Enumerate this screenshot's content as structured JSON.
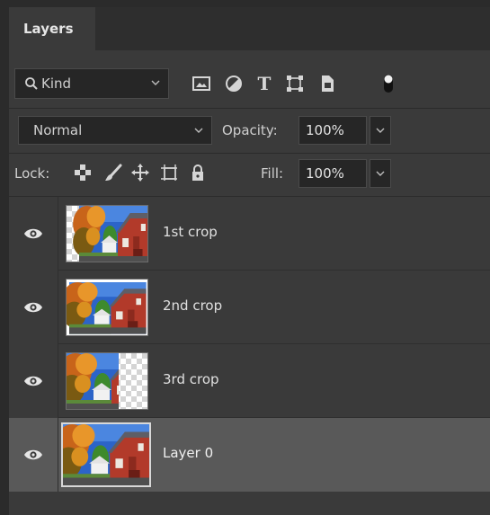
{
  "panel": {
    "tab_label": "Layers"
  },
  "filter": {
    "kind_label": "Kind",
    "icons": [
      "image-filter-icon",
      "adjustment-filter-icon",
      "type-filter-icon",
      "shape-filter-icon",
      "smart-object-filter-icon",
      "filter-toggle-icon"
    ]
  },
  "blend": {
    "mode": "Normal",
    "opacity_label": "Opacity:",
    "opacity_value": "100%"
  },
  "lock": {
    "label": "Lock:",
    "icons": [
      "lock-transparent-pixels-icon",
      "lock-image-pixels-icon",
      "lock-position-icon",
      "lock-artboard-icon",
      "lock-all-icon"
    ],
    "fill_label": "Fill:",
    "fill_value": "100%"
  },
  "layers": [
    {
      "name": "1st crop",
      "selected": false,
      "visible": true
    },
    {
      "name": "2nd crop",
      "selected": false,
      "visible": true
    },
    {
      "name": "3rd crop",
      "selected": false,
      "visible": true
    },
    {
      "name": "Layer 0",
      "selected": true,
      "visible": true
    }
  ],
  "colors": {
    "panel_bg": "#3a3a3a",
    "selected_row": "#595959",
    "input_bg": "#262626",
    "barn_red": "#b23a2a",
    "sky_blue": "#2c64c8"
  }
}
